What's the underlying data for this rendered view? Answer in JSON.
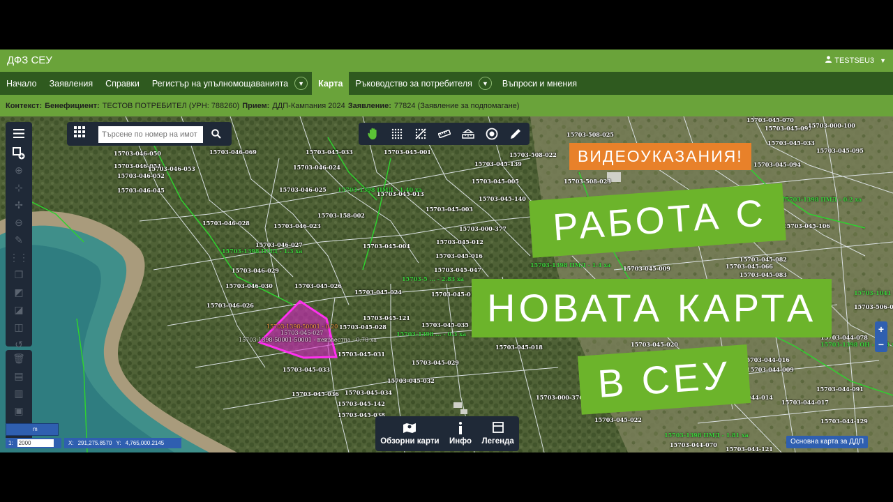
{
  "header": {
    "brand": "ДФЗ СЕУ",
    "user": "TESTSEU3"
  },
  "nav": {
    "items": [
      {
        "label": "Начало"
      },
      {
        "label": "Заявления"
      },
      {
        "label": "Справки"
      },
      {
        "label": "Регистър на упълномощаванията"
      },
      {
        "label": "Карта"
      },
      {
        "label": "Ръководство за потребителя"
      },
      {
        "label": "Въпроси и мнения"
      }
    ],
    "active": "Карта"
  },
  "context": {
    "context_label": "Контекст:",
    "beneficiary_label": "Бенефициент:",
    "beneficiary_value": "ТЕСТОВ ПОТРЕБИТЕЛ (УРН: 788260)",
    "intake_label": "Прием:",
    "intake_value": "ДДП-Кампания 2024",
    "application_label": "Заявление:",
    "application_value": "77824 (Заявление за подпомагане)"
  },
  "search": {
    "placeholder": "Търсене по номер на имот"
  },
  "bottom_tools": {
    "overview": "Обзорни карти",
    "info": "Инфо",
    "legend": "Легенда"
  },
  "map": {
    "scale_unit": "m",
    "scale_prefix": "1:",
    "scale_value": "2000",
    "x_label": "X:",
    "x_value": "291,275.8570",
    "y_label": "Y:",
    "y_value": "4,765,000.2145",
    "basemap_label": "Основна карта за ДДП",
    "zoom_in": "+",
    "zoom_out": "−",
    "highlight_label_1": "15703-1398-50001 - 0.20",
    "highlight_label_2": "15703-045-027",
    "highlight_label_3": "15703-1398-50001-50001 - неизвестна - 0.78 ха",
    "parcels": [
      "15703-046-050",
      "15703-046-054",
      "15703-046-052",
      "15703-046-053",
      "15703-046-045",
      "15703-046-069",
      "15703-045-033",
      "15703-046-024",
      "15703-046-025",
      "15703-046-028",
      "15703-046-023",
      "15703-046-027",
      "15703-046-029",
      "15703-046-030",
      "15703-046-026",
      "15703-045-026",
      "15703-045-024",
      "15703-045-121",
      "15703-045-028",
      "15703-045-031",
      "15703-045-033",
      "15703-045-032",
      "15703-045-036",
      "15703-045-034",
      "15703-045-142",
      "15703-045-038",
      "15703-045-004",
      "15703-045-012",
      "15703-045-016",
      "15703-045-047",
      "15703-045-017",
      "15703-045-035",
      "15703-045-018",
      "15703-045-029",
      "15703-045-013",
      "15703-045-003",
      "15703-045-005",
      "15703-045-139",
      "15703-045-140",
      "15703-045-001",
      "15703-158-002",
      "15703-000-377",
      "15703-508-025",
      "15703-508-022",
      "15703-508-023",
      "15703-045-009",
      "15703-045-020",
      "15703-000-376",
      "15703-045-022",
      "15703-045-070",
      "15703-045-097",
      "15703-045-033",
      "15703-045-094",
      "15703-045-095",
      "15703-045-106",
      "15703-045-083",
      "15703-045-066",
      "15703-045-082",
      "15703-044-078",
      "15703-044-016",
      "15703-044-009",
      "15703-044-014",
      "15703-044-017",
      "15703-044-091",
      "15703-044-129",
      "15703-044-070",
      "15703-044-121",
      "15703-000-100",
      "15703-506-03"
    ],
    "green_labels": [
      "15703-1398 ПМД - 1.3 ха",
      "15703-1398 ПМД - 1.40 ха",
      "15703-5 ... - 2.83 ха",
      "15703-1398 ... - 0.3 ха",
      "15703-1398 ПМД - 0.2 ха",
      "15703-1398 ОН - 0.68 ха",
      "15703-1398 ПМД - 1.81 ха",
      "15703-1041 ПМД - 2.2 ха",
      "15703-1398 ПМД - 1.4 ха"
    ]
  },
  "promo": {
    "tag": "ВИДЕОУКАЗАНИЯ!",
    "line1": "РАБОТА С",
    "line2": "НОВАТА КАРТА",
    "line3": "В СЕУ"
  },
  "colors": {
    "header_green": "#6aa33a",
    "nav_dark_green": "#2f5a1f",
    "panel_dark": "#1f2937",
    "promo_green": "#6cb42b",
    "promo_orange": "#e8812a",
    "highlight_magenta": "#e020d0",
    "map_blue": "#2f5fb0"
  }
}
